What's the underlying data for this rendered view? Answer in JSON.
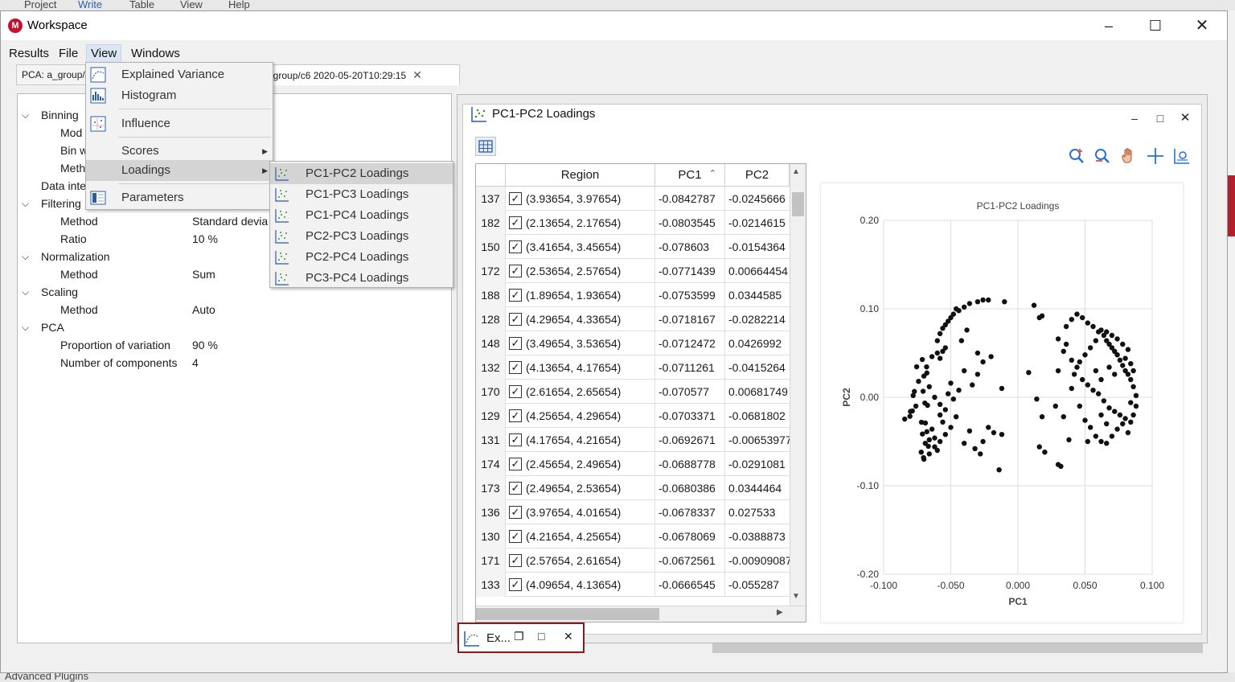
{
  "background_app": {
    "menu": [
      "Project",
      "Write",
      "Table",
      "View",
      "Help"
    ],
    "bottom_text": "Advanced Plugins"
  },
  "window": {
    "title": "Workspace",
    "logo": "M",
    "controls": [
      "minimize-icon",
      "maximize-icon",
      "close-icon"
    ]
  },
  "menubar": [
    "Results",
    "File",
    "View",
    "Windows"
  ],
  "tabs": [
    {
      "label": "PCA: a_group/",
      "active": false
    },
    {
      "label": "c_group/c6 2020-05-20T10:29:15",
      "active": true
    }
  ],
  "tree": [
    {
      "label": "Binning",
      "level": 0,
      "expanded": true
    },
    {
      "label": "Mod",
      "level": 1
    },
    {
      "label": "Bin w",
      "level": 1
    },
    {
      "label": "Meth",
      "level": 1
    },
    {
      "label": "Data inte",
      "level": 0
    },
    {
      "label": "Filtering",
      "level": 0,
      "expanded": true
    },
    {
      "label": "Method",
      "level": 1,
      "value": "Standard devia"
    },
    {
      "label": "Ratio",
      "level": 1,
      "value": "10 %"
    },
    {
      "label": "Normalization",
      "level": 0,
      "expanded": true
    },
    {
      "label": "Method",
      "level": 1,
      "value": "Sum"
    },
    {
      "label": "Scaling",
      "level": 0,
      "expanded": true
    },
    {
      "label": "Method",
      "level": 1,
      "value": "Auto"
    },
    {
      "label": "PCA",
      "level": 0,
      "expanded": true
    },
    {
      "label": "Proportion of variation",
      "level": 1,
      "value": "90 %"
    },
    {
      "label": "Number of components",
      "level": 1,
      "value": "4"
    }
  ],
  "view_menu": {
    "items": [
      {
        "label": "Explained Variance",
        "icon": "line-chart-icon"
      },
      {
        "label": "Histogram",
        "icon": "histogram-icon"
      },
      {
        "label": "Influence",
        "icon": "influence-chart-icon"
      },
      {
        "label": "Scores",
        "submenu": true
      },
      {
        "label": "Loadings",
        "submenu": true,
        "highlighted": true
      },
      {
        "label": "Parameters",
        "icon": "parameters-icon"
      }
    ]
  },
  "loadings_submenu": [
    {
      "label": "PC1-PC2 Loadings",
      "highlighted": true
    },
    {
      "label": "PC1-PC3 Loadings"
    },
    {
      "label": "PC1-PC4 Loadings"
    },
    {
      "label": "PC2-PC3 Loadings"
    },
    {
      "label": "PC2-PC4 Loadings"
    },
    {
      "label": "PC3-PC4 Loadings"
    }
  ],
  "inner_window": {
    "title": "PC1-PC2 Loadings",
    "controls": [
      "minimize-icon",
      "maximize-icon",
      "close-icon"
    ],
    "toolbar": [
      "zoom-in-icon",
      "zoom-reset-icon",
      "pan-hand-icon",
      "crosshair-icon",
      "chart-settings-icon"
    ]
  },
  "table": {
    "columns": [
      "Region",
      "PC1",
      "PC2"
    ],
    "sort_column": "PC1",
    "rows": [
      {
        "id": "137",
        "checked": true,
        "region": "(3.93654, 3.97654)",
        "pc1": "-0.0842787",
        "pc2": "-0.0245666"
      },
      {
        "id": "182",
        "checked": true,
        "region": "(2.13654, 2.17654)",
        "pc1": "-0.0803545",
        "pc2": "-0.0214615"
      },
      {
        "id": "150",
        "checked": true,
        "region": "(3.41654, 3.45654)",
        "pc1": "-0.078603",
        "pc2": "-0.0154364"
      },
      {
        "id": "172",
        "checked": true,
        "region": "(2.53654, 2.57654)",
        "pc1": "-0.0771439",
        "pc2": "0.00664454"
      },
      {
        "id": "188",
        "checked": true,
        "region": "(1.89654, 1.93654)",
        "pc1": "-0.0753599",
        "pc2": "0.0344585"
      },
      {
        "id": "128",
        "checked": true,
        "region": "(4.29654, 4.33654)",
        "pc1": "-0.0718167",
        "pc2": "-0.0282214"
      },
      {
        "id": "148",
        "checked": true,
        "region": "(3.49654, 3.53654)",
        "pc1": "-0.0712472",
        "pc2": "0.0426992"
      },
      {
        "id": "132",
        "checked": true,
        "region": "(4.13654, 4.17654)",
        "pc1": "-0.0711261",
        "pc2": "-0.0415264"
      },
      {
        "id": "170",
        "checked": true,
        "region": "(2.61654, 2.65654)",
        "pc1": "-0.070577",
        "pc2": "0.00681749"
      },
      {
        "id": "129",
        "checked": true,
        "region": "(4.25654, 4.29654)",
        "pc1": "-0.0703371",
        "pc2": "-0.0681802"
      },
      {
        "id": "131",
        "checked": true,
        "region": "(4.17654, 4.21654)",
        "pc1": "-0.0692671",
        "pc2": "-0.00653977"
      },
      {
        "id": "174",
        "checked": true,
        "region": "(2.45654, 2.49654)",
        "pc1": "-0.0688778",
        "pc2": "-0.0291081"
      },
      {
        "id": "173",
        "checked": true,
        "region": "(2.49654, 2.53654)",
        "pc1": "-0.0680386",
        "pc2": "0.0344464"
      },
      {
        "id": "136",
        "checked": true,
        "region": "(3.97654, 4.01654)",
        "pc1": "-0.0678337",
        "pc2": "0.027533"
      },
      {
        "id": "130",
        "checked": true,
        "region": "(4.21654, 4.25654)",
        "pc1": "-0.0678069",
        "pc2": "-0.0388873"
      },
      {
        "id": "171",
        "checked": true,
        "region": "(2.57654, 2.61654)",
        "pc1": "-0.0672561",
        "pc2": "-0.00909087"
      },
      {
        "id": "133",
        "checked": true,
        "region": "(4.09654, 4.13654)",
        "pc1": "-0.0666545",
        "pc2": "-0.055287"
      }
    ]
  },
  "minimized": {
    "label": "Ex...",
    "controls": [
      "restore-icon",
      "maximize-icon",
      "close-icon"
    ]
  },
  "chart_data": {
    "type": "scatter",
    "title": "PC1-PC2 Loadings",
    "xlabel": "PC1",
    "ylabel": "PC2",
    "xlim": [
      -0.1,
      0.1
    ],
    "ylim": [
      -0.2,
      0.2
    ],
    "xticks": [
      "-0.100",
      "-0.050",
      "0.000",
      "0.050",
      "0.100"
    ],
    "yticks": [
      "0.20",
      "0.10",
      "0.00",
      "-0.10",
      "-0.20"
    ],
    "grid": true,
    "point_color": "#111111",
    "points": [
      [
        -0.0843,
        -0.0246
      ],
      [
        -0.0804,
        -0.0215
      ],
      [
        -0.0786,
        -0.0154
      ],
      [
        -0.0771,
        0.0066
      ],
      [
        -0.0754,
        0.0345
      ],
      [
        -0.0718,
        -0.0282
      ],
      [
        -0.0712,
        0.0427
      ],
      [
        -0.0711,
        -0.0415
      ],
      [
        -0.0706,
        0.0068
      ],
      [
        -0.0703,
        -0.0682
      ],
      [
        -0.0693,
        -0.0065
      ],
      [
        -0.0689,
        -0.0291
      ],
      [
        -0.068,
        0.0344
      ],
      [
        -0.0678,
        0.0275
      ],
      [
        -0.0678,
        -0.0389
      ],
      [
        -0.0673,
        -0.0091
      ],
      [
        -0.0667,
        -0.0553
      ],
      [
        -0.072,
        -0.062
      ],
      [
        -0.069,
        -0.052
      ],
      [
        -0.066,
        -0.048
      ],
      [
        -0.064,
        -0.036
      ],
      [
        -0.062,
        -0.056
      ],
      [
        -0.06,
        -0.06
      ],
      [
        -0.058,
        -0.05
      ],
      [
        -0.056,
        -0.028
      ],
      [
        -0.054,
        -0.014
      ],
      [
        -0.052,
        0.004
      ],
      [
        -0.05,
        0.016
      ],
      [
        -0.064,
        0.046
      ],
      [
        -0.06,
        0.05
      ],
      [
        -0.058,
        0.044
      ],
      [
        -0.056,
        0.052
      ],
      [
        -0.054,
        0.056
      ],
      [
        -0.06,
        0.064
      ],
      [
        -0.058,
        0.072
      ],
      [
        -0.056,
        0.078
      ],
      [
        -0.054,
        0.082
      ],
      [
        -0.052,
        0.086
      ],
      [
        -0.05,
        0.09
      ],
      [
        -0.048,
        0.094
      ],
      [
        -0.046,
        0.1
      ],
      [
        -0.044,
        0.098
      ],
      [
        -0.04,
        0.102
      ],
      [
        -0.036,
        0.106
      ],
      [
        -0.03,
        0.108
      ],
      [
        -0.026,
        0.11
      ],
      [
        -0.022,
        0.11
      ],
      [
        -0.01,
        0.108
      ],
      [
        -0.074,
        0.018
      ],
      [
        -0.07,
        0.024
      ],
      [
        -0.066,
        0.012
      ],
      [
        -0.062,
        0.0
      ],
      [
        -0.058,
        -0.008
      ],
      [
        -0.054,
        -0.042
      ],
      [
        -0.05,
        -0.034
      ],
      [
        -0.046,
        -0.022
      ],
      [
        -0.04,
        -0.052
      ],
      [
        -0.036,
        -0.038
      ],
      [
        -0.032,
        -0.058
      ],
      [
        -0.028,
        -0.064
      ],
      [
        -0.026,
        -0.05
      ],
      [
        -0.022,
        -0.034
      ],
      [
        -0.018,
        -0.04
      ],
      [
        -0.014,
        -0.082
      ],
      [
        -0.012,
        -0.042
      ],
      [
        -0.042,
        0.064
      ],
      [
        -0.038,
        0.076
      ],
      [
        -0.03,
        0.05
      ],
      [
        -0.026,
        0.04
      ],
      [
        -0.02,
        0.046
      ],
      [
        -0.012,
        0.01
      ],
      [
        -0.048,
        -0.002
      ],
      [
        -0.044,
        0.008
      ],
      [
        -0.04,
        0.03
      ],
      [
        -0.034,
        0.014
      ],
      [
        -0.03,
        0.026
      ],
      [
        -0.07,
        -0.07
      ],
      [
        -0.066,
        -0.064
      ],
      [
        -0.062,
        -0.046
      ],
      [
        -0.058,
        -0.02
      ],
      [
        -0.076,
        -0.01
      ],
      [
        -0.078,
        0.002
      ],
      [
        -0.08,
        -0.016
      ],
      [
        0.012,
        0.104
      ],
      [
        0.018,
        0.092
      ],
      [
        0.016,
        0.09
      ],
      [
        0.008,
        0.028
      ],
      [
        0.014,
        -0.002
      ],
      [
        0.018,
        -0.022
      ],
      [
        0.03,
        0.066
      ],
      [
        0.036,
        0.06
      ],
      [
        0.034,
        0.052
      ],
      [
        0.04,
        0.042
      ],
      [
        0.044,
        0.034
      ],
      [
        0.048,
        0.02
      ],
      [
        0.052,
        0.014
      ],
      [
        0.056,
        0.008
      ],
      [
        0.06,
        0.004
      ],
      [
        0.064,
        -0.004
      ],
      [
        0.068,
        -0.012
      ],
      [
        0.072,
        -0.016
      ],
      [
        0.076,
        -0.02
      ],
      [
        0.08,
        -0.024
      ],
      [
        0.084,
        -0.028
      ],
      [
        0.086,
        -0.02
      ],
      [
        0.088,
        -0.01
      ],
      [
        0.088,
        0.002
      ],
      [
        0.086,
        0.012
      ],
      [
        0.084,
        0.02
      ],
      [
        0.082,
        0.026
      ],
      [
        0.08,
        0.03
      ],
      [
        0.078,
        0.036
      ],
      [
        0.076,
        0.042
      ],
      [
        0.074,
        0.048
      ],
      [
        0.072,
        0.052
      ],
      [
        0.07,
        0.056
      ],
      [
        0.068,
        0.06
      ],
      [
        0.066,
        0.064
      ],
      [
        0.064,
        0.07
      ],
      [
        0.06,
        0.074
      ],
      [
        0.056,
        0.08
      ],
      [
        0.052,
        0.084
      ],
      [
        0.048,
        0.09
      ],
      [
        0.044,
        0.094
      ],
      [
        0.04,
        0.088
      ],
      [
        0.036,
        0.08
      ],
      [
        0.08,
        0.044
      ],
      [
        0.084,
        0.038
      ],
      [
        0.086,
        0.03
      ],
      [
        0.082,
        0.054
      ],
      [
        0.078,
        0.06
      ],
      [
        0.074,
        0.066
      ],
      [
        0.07,
        0.07
      ],
      [
        0.066,
        0.074
      ],
      [
        0.062,
        0.076
      ],
      [
        0.058,
        0.064
      ],
      [
        0.054,
        0.056
      ],
      [
        0.05,
        0.048
      ],
      [
        0.046,
        0.04
      ],
      [
        0.042,
        0.026
      ],
      [
        0.03,
        0.03
      ],
      [
        0.028,
        -0.01
      ],
      [
        0.034,
        -0.022
      ],
      [
        0.038,
        -0.048
      ],
      [
        0.032,
        -0.078
      ],
      [
        0.03,
        -0.076
      ],
      [
        0.016,
        -0.056
      ],
      [
        0.02,
        -0.062
      ],
      [
        0.05,
        -0.026
      ],
      [
        0.054,
        -0.034
      ],
      [
        0.058,
        -0.044
      ],
      [
        0.062,
        -0.05
      ],
      [
        0.066,
        -0.052
      ],
      [
        0.07,
        -0.044
      ],
      [
        0.074,
        -0.036
      ],
      [
        0.078,
        -0.03
      ],
      [
        0.082,
        -0.04
      ],
      [
        0.084,
        -0.006
      ],
      [
        0.062,
        -0.02
      ],
      [
        0.066,
        -0.03
      ],
      [
        0.052,
        -0.05
      ],
      [
        0.04,
        0.01
      ],
      [
        0.046,
        -0.01
      ],
      [
        0.058,
        0.03
      ],
      [
        0.062,
        0.02
      ],
      [
        0.068,
        0.034
      ],
      [
        0.072,
        0.026
      ]
    ]
  }
}
